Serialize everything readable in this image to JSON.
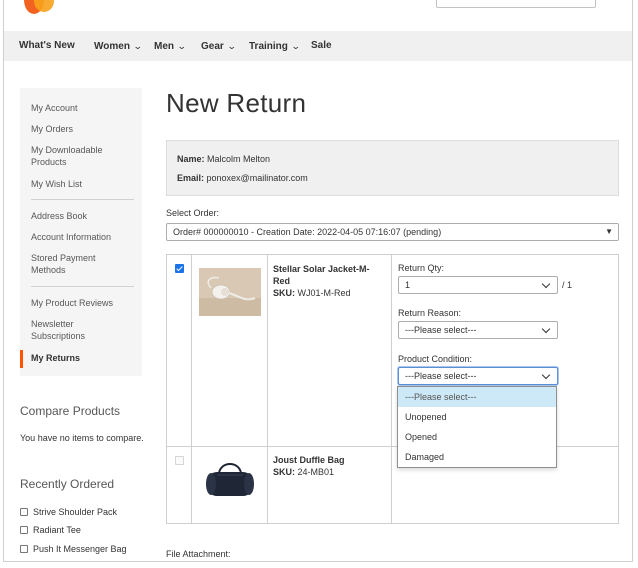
{
  "colors": {
    "accent": "#ff5501",
    "nav_bg": "#f0f0f0",
    "sidebar_bg": "#f5f5f5",
    "highlight": "#cde8f6",
    "checkbox": "#1a73e8"
  },
  "nav": {
    "items": [
      {
        "label": "What's New",
        "has_dropdown": false
      },
      {
        "label": "Women",
        "has_dropdown": true
      },
      {
        "label": "Men",
        "has_dropdown": true
      },
      {
        "label": "Gear",
        "has_dropdown": true
      },
      {
        "label": "Training",
        "has_dropdown": true
      },
      {
        "label": "Sale",
        "has_dropdown": false
      }
    ]
  },
  "sidebar": {
    "items": [
      {
        "label": "My Account"
      },
      {
        "label": "My Orders"
      },
      {
        "label": "My Downloadable Products"
      },
      {
        "label": "My Wish List"
      },
      {
        "label": "Address Book"
      },
      {
        "label": "Account Information"
      },
      {
        "label": "Stored Payment Methods"
      },
      {
        "label": "My Product Reviews"
      },
      {
        "label": "Newsletter Subscriptions"
      },
      {
        "label": "My Returns",
        "current": true
      }
    ]
  },
  "compare": {
    "title": "Compare Products",
    "empty_text": "You have no items to compare."
  },
  "recent": {
    "title": "Recently Ordered",
    "items": [
      "Strive Shoulder Pack",
      "Radiant Tee",
      "Push It Messenger Bag"
    ]
  },
  "page": {
    "title": "New Return"
  },
  "customer": {
    "name_label": "Name:",
    "name": "Malcolm Melton",
    "email_label": "Email:",
    "email": "ponoxex@mailinator.com"
  },
  "order_select": {
    "label": "Select Order:",
    "value": "Order# 000000010 - Creation Date: 2022-04-05 07:16:07 (pending)"
  },
  "items": [
    {
      "checked": true,
      "name": "Stellar Solar Jacket-M-Red",
      "sku_label": "SKU:",
      "sku": "WJ01-M-Red",
      "return_qty_label": "Return Qty:",
      "return_qty": "1",
      "qty_suffix": "/ 1",
      "reason_label": "Return Reason:",
      "reason_value": "---Please select---",
      "condition_label": "Product Condition:",
      "condition_value": "---Please select---"
    },
    {
      "checked": false,
      "name": "Joust Duffle Bag",
      "sku_label": "SKU:",
      "sku": "24-MB01"
    }
  ],
  "condition_dropdown": {
    "options": [
      "---Please select---",
      "Unopened",
      "Opened",
      "Damaged"
    ],
    "highlighted": 0
  },
  "file_attachment": {
    "label": "File Attachment:"
  }
}
